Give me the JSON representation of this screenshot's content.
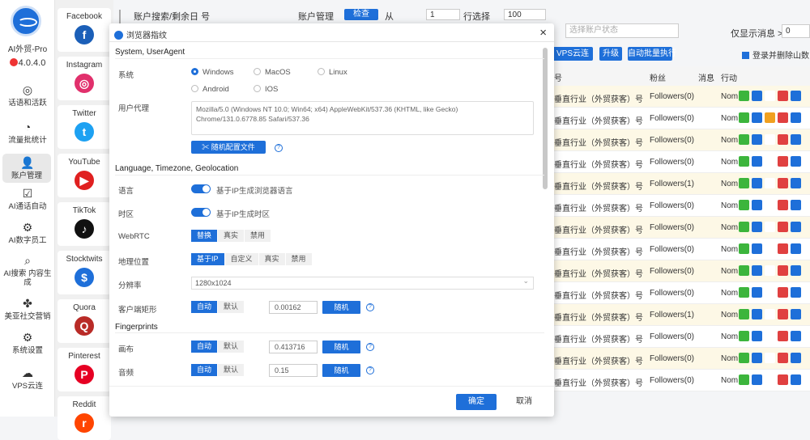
{
  "app": {
    "name": "AI外贸-Pro",
    "version": "4.0.4.0"
  },
  "sidebar": {
    "items": [
      {
        "label": "话语和活跃",
        "icon": "target-icon"
      },
      {
        "label": "流量批统计",
        "icon": "gauge-icon"
      },
      {
        "label": "账户管理",
        "icon": "users-icon"
      },
      {
        "label": "AI通话自动",
        "icon": "clipboard-icon"
      },
      {
        "label": "AI数字员工",
        "icon": "robot-icon"
      },
      {
        "label": "AI搜索 内容生成",
        "icon": "search-icon"
      },
      {
        "label": "美亚社交营销",
        "icon": "clover-icon"
      },
      {
        "label": "系统设置",
        "icon": "gear-icon"
      },
      {
        "label": "VPS云连",
        "icon": "vps-icon"
      }
    ]
  },
  "social": [
    {
      "label": "Facebook",
      "glyph": "f",
      "color": "#1b5fb8"
    },
    {
      "label": "Instagram",
      "glyph": "◎",
      "color": "#e1306c"
    },
    {
      "label": "Twitter",
      "glyph": "t",
      "color": "#1da1f2"
    },
    {
      "label": "YouTube",
      "glyph": "▶",
      "color": "#e02020"
    },
    {
      "label": "TikTok",
      "glyph": "♪",
      "color": "#111111"
    },
    {
      "label": "Stocktwits",
      "glyph": "$",
      "color": "#1e6fd9"
    },
    {
      "label": "Quora",
      "glyph": "Q",
      "color": "#b92b27"
    },
    {
      "label": "Pinterest",
      "glyph": "P",
      "color": "#e60023"
    },
    {
      "label": "Reddit",
      "glyph": "r",
      "color": "#ff4500"
    }
  ],
  "background": {
    "search_label": "账户搜索/剩余日 号",
    "mgmt_label": "账户管理",
    "check_btn": "检查",
    "from_label": "从",
    "from_value": "1",
    "to_label": "行选择",
    "to_value": "100",
    "status_placeholder": "选择账户状态",
    "filter_label": "仅显示消息 >=",
    "filter_value": "0",
    "btn_vps": "VPS云连",
    "btn_upgrade": "升级",
    "btn_batch": "自动批量执行",
    "checkbox_label": "登录并删除山数",
    "columns": [
      "号",
      "粉丝",
      "消息",
      "行动"
    ],
    "rows": [
      {
        "name": "垂直行业（外贸获客）号",
        "followers": "Followers(0)",
        "note": "Nom",
        "hl": true
      },
      {
        "name": "垂直行业（外贸获客）号",
        "followers": "Followers(0)",
        "note": "Nom",
        "hl": false
      },
      {
        "name": "垂直行业（外贸获客）号",
        "followers": "Followers(0)",
        "note": "Nom",
        "hl": true
      },
      {
        "name": "垂直行业（外贸获客）号",
        "followers": "Followers(0)",
        "note": "Nom",
        "hl": false
      },
      {
        "name": "垂直行业（外贸获客）号",
        "followers": "Followers(1)",
        "note": "Nom",
        "hl": true
      },
      {
        "name": "垂直行业（外贸获客）号",
        "followers": "Followers(0)",
        "note": "Nom",
        "hl": false
      },
      {
        "name": "垂直行业（外贸获客）号",
        "followers": "Followers(0)",
        "note": "Nom",
        "hl": true
      },
      {
        "name": "垂直行业（外贸获客）号",
        "followers": "Followers(0)",
        "note": "Nom",
        "hl": false
      },
      {
        "name": "垂直行业（外贸获客）号",
        "followers": "Followers(0)",
        "note": "Nom",
        "hl": true
      },
      {
        "name": "垂直行业（外贸获客）号",
        "followers": "Followers(0)",
        "note": "Nom",
        "hl": false
      },
      {
        "name": "垂直行业（外贸获客）号",
        "followers": "Followers(1)",
        "note": "Nom",
        "hl": true
      },
      {
        "name": "垂直行业（外贸获客）号",
        "followers": "Followers(0)",
        "note": "Nom",
        "hl": false
      },
      {
        "name": "垂直行业（外贸获客）号",
        "followers": "Followers(0)",
        "note": "Nom",
        "hl": true
      },
      {
        "name": "垂直行业（外贸获客）号",
        "followers": "Followers(0)",
        "note": "Nom",
        "hl": false
      }
    ]
  },
  "modal": {
    "title": "浏览器指纹",
    "section_system": "System, UserAgent",
    "os_label": "系统",
    "os_options": [
      "Windows",
      "MacOS",
      "Linux",
      "Android",
      "IOS"
    ],
    "os_selected": "Windows",
    "ua_label": "用户代理",
    "ua_value": "Mozilla/5.0 (Windows NT 10.0; Win64; x64) AppleWebKit/537.36 (KHTML, like Gecko) Chrome/131.0.6778.85 Safari/537.36",
    "ua_btn": "✂ 随机配置文件",
    "section_lang": "Language, Timezone, Geolocation",
    "lang_label": "语言",
    "lang_toggle": "基于IP生成浏览器语言",
    "tz_label": "时区",
    "tz_toggle": "基于IP生成时区",
    "webrtc_label": "WebRTC",
    "webrtc_options": [
      "替换",
      "真实",
      "禁用"
    ],
    "webrtc_selected": "替换",
    "geo_label": "地理位置",
    "geo_options": [
      "基于IP",
      "自定义",
      "真实",
      "禁用"
    ],
    "geo_selected": "基于IP",
    "res_label": "分辨率",
    "res_value": "1280x1024",
    "client_label": "客户端矩形",
    "client_options": [
      "自动",
      "默认"
    ],
    "client_value": "0.00162",
    "section_fp": "Fingerprints",
    "canvas_label": "画布",
    "canvas_options": [
      "自动",
      "默认"
    ],
    "canvas_value": "0.413716",
    "audio_label": "音频",
    "audio_options": [
      "自动",
      "默认"
    ],
    "audio_value": "0.15",
    "random_btn": "随机",
    "ok_btn": "确定",
    "cancel_btn": "取消"
  }
}
